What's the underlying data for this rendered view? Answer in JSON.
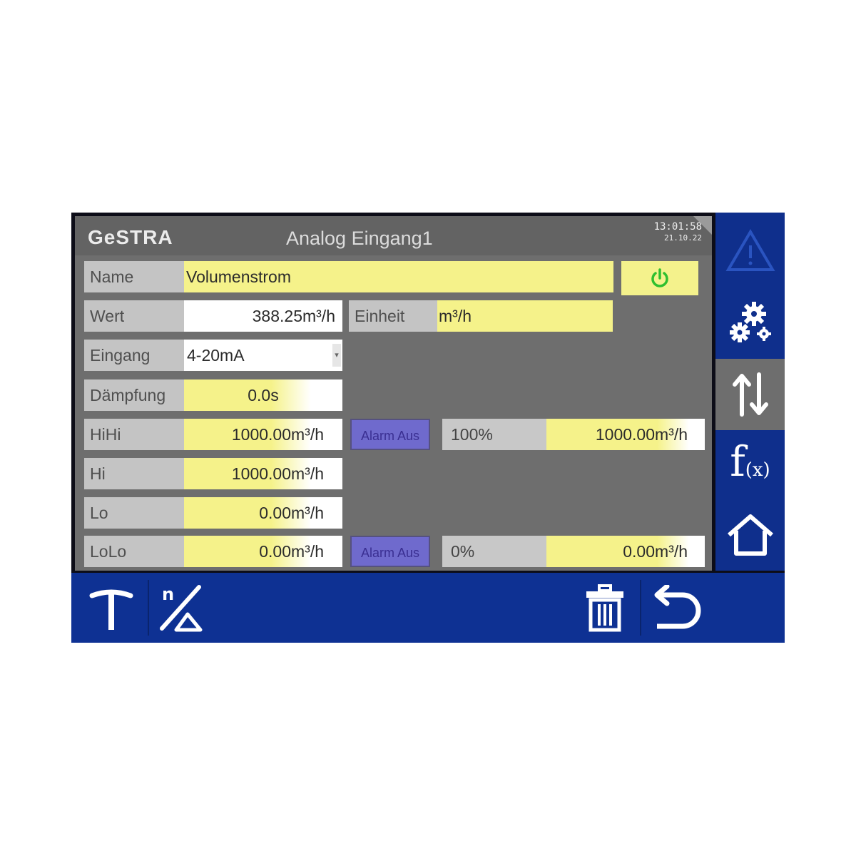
{
  "header": {
    "brand": "GeSTRA",
    "title": "Analog Eingang1",
    "time": "13:01:58",
    "date": "21.10.22"
  },
  "form": {
    "name_label": "Name",
    "name_value": "Volumenstrom",
    "wert_label": "Wert",
    "wert_value": "388.25m³/h",
    "einheit_label": "Einheit",
    "einheit_value": "m³/h",
    "eingang_label": "Eingang",
    "eingang_value": "4-20mA",
    "daempfung_label": "Dämpfung",
    "daempfung_value": "0.0s",
    "hihi_label": "HiHi",
    "hihi_value": "1000.00m³/h",
    "hi_label": "Hi",
    "hi_value": "1000.00m³/h",
    "lo_label": "Lo",
    "lo_value": "0.00m³/h",
    "lolo_label": "LoLo",
    "lolo_value": "0.00m³/h"
  },
  "alarms": {
    "upper_button": "Alarm Aus",
    "upper_pct": "100%",
    "upper_value": "1000.00m³/h",
    "lower_button": "Alarm Aus",
    "lower_pct": "0%",
    "lower_value": "0.00m³/h"
  },
  "sidebar": {
    "items": [
      "warning-icon",
      "settings-gears-icon",
      "io-arrows-icon",
      "function-icon",
      "home-icon"
    ],
    "function_label": "f",
    "function_sub": "(x)"
  },
  "toolbar": {
    "left": [
      "tare-icon",
      "scaling-icon"
    ],
    "right": [
      "delete-icon",
      "back-icon"
    ]
  },
  "colors": {
    "accent_blue": "#0f2f8c",
    "field_yellow": "#f5f28a",
    "panel_gray": "#6e6e6e",
    "label_gray": "#c4c4c4",
    "alarm_purple": "#6f6acd",
    "power_green": "#2fbf2f"
  }
}
